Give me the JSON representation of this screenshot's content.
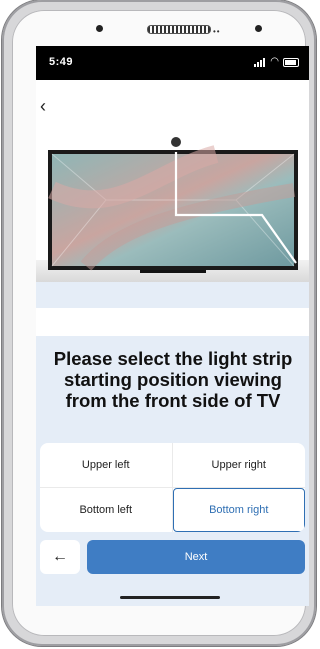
{
  "status_bar": {
    "time": "5:49"
  },
  "question": {
    "title": "Please select the light strip starting position viewing from the front side of TV"
  },
  "options": [
    {
      "label": "Upper left",
      "selected": false
    },
    {
      "label": "Upper right",
      "selected": false
    },
    {
      "label": "Bottom left",
      "selected": false
    },
    {
      "label": "Bottom right",
      "selected": true
    }
  ],
  "footer": {
    "next_label": "Next"
  },
  "icons": {
    "back": "chevron-left-icon",
    "footer_back": "arrow-left-icon",
    "signal": "signal-icon",
    "wifi": "wifi-icon",
    "battery": "battery-icon"
  },
  "colors": {
    "accent": "#3f7dc4",
    "selected_border": "#2f6fb3",
    "background": "#e5edf7",
    "light_strip": "#ffffff"
  }
}
